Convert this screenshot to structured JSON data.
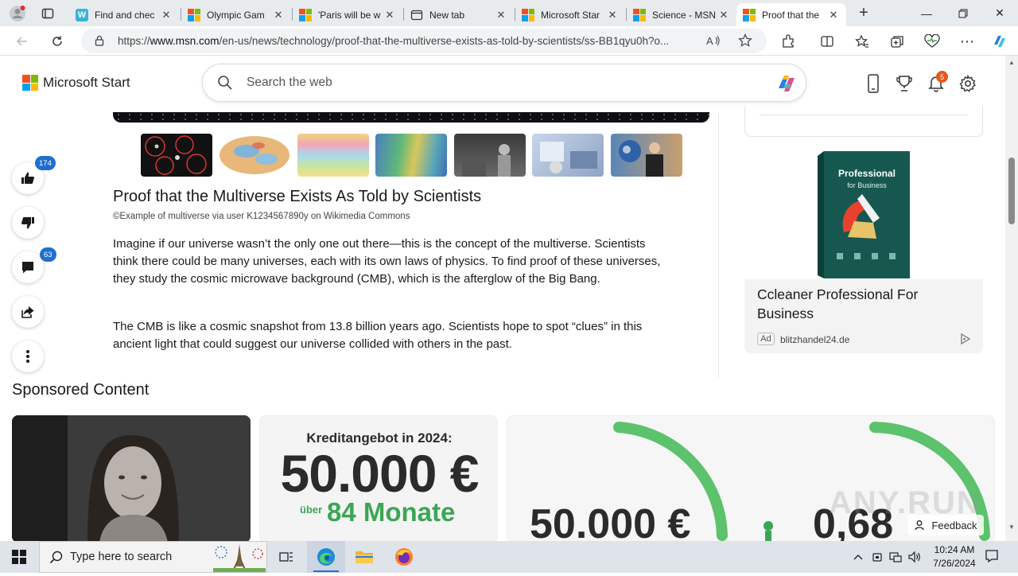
{
  "browser": {
    "tabs": [
      {
        "title": "Find and chec",
        "active": false
      },
      {
        "title": "Olympic Gam",
        "active": false
      },
      {
        "title": "'Paris will be w",
        "active": false
      },
      {
        "title": "New tab",
        "active": false
      },
      {
        "title": "Microsoft Star",
        "active": false
      },
      {
        "title": "Science - MSN",
        "active": false
      },
      {
        "title": "Proof that the",
        "active": true
      }
    ],
    "url_prefix": "https://",
    "url_host": "www.msn.com",
    "url_path": "/en-us/news/technology/proof-that-the-multiverse-exists-as-told-by-scientists/ss-BB1qyu0h?o..."
  },
  "header": {
    "brand": "Microsoft Start",
    "search_placeholder": "Search the web",
    "notification_count": "5"
  },
  "actions": {
    "likes": "174",
    "comments": "63"
  },
  "article": {
    "title": "Proof that the Multiverse Exists As Told by Scientists",
    "caption": "©Example of multiverse via user K1234567890y on Wikimedia Commons",
    "paragraphs": [
      "Imagine if our universe wasn’t the only one out there—this is the concept of the multiverse. Scientists think there could be many universes, each with its own laws of physics. To find proof of these universes, they study the cosmic microwave background (CMB), which is the afterglow of the Big Bang.",
      "The CMB is like a cosmic snapshot from 13.8 billion years ago. Scientists hope to spot “clues” in this ancient light that could suggest our universe collided with others in the past."
    ]
  },
  "ad": {
    "box_title": "Professional",
    "box_subtitle": "for Business",
    "title": "Ccleaner Professional For Business",
    "tag": "Ad",
    "domain": "blitzhandel24.de"
  },
  "sponsored": {
    "heading": "Sponsored Content",
    "card2_line1": "Kreditangebot in 2024:",
    "card2_amount": "50.000 €",
    "card2_prefix": "über",
    "card2_term": "84 Monate",
    "card3_amount": "50.000 €",
    "card3_rate": "0,68"
  },
  "feedback": "Feedback",
  "watermark": "ANY.RUN",
  "taskbar": {
    "search_placeholder": "Type here to search",
    "time": "10:24 AM",
    "date": "7/26/2024"
  },
  "colors": {
    "accent_blue": "#1f6fd0",
    "notif_orange": "#e5591a",
    "loan_green": "#3aa655"
  }
}
